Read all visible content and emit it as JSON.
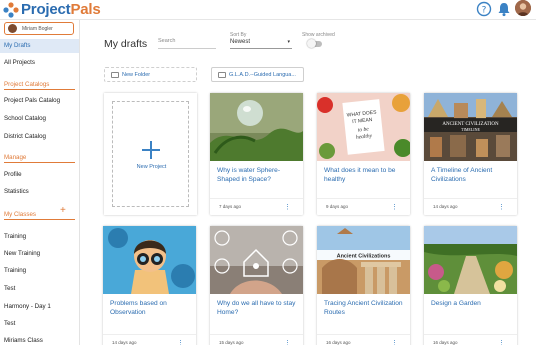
{
  "app": {
    "name_part1": "Project",
    "name_part2": "Pals"
  },
  "header": {
    "help_icon": "help-circle-icon",
    "bell_icon": "bell-icon"
  },
  "sidebar": {
    "user_name": "Miriam Bogler",
    "items_top": [
      {
        "label": "My Drafts",
        "active": true
      },
      {
        "label": "All Projects",
        "active": false
      }
    ],
    "catalogs_title": "Project Catalogs",
    "catalogs": [
      "Project Pals Catalog",
      "School Catalog",
      "District Catalog"
    ],
    "manage_title": "Manage",
    "manage": [
      "Profile",
      "Statistics"
    ],
    "classes_title": "My Classes",
    "classes": [
      "Training",
      "New Training",
      "Training",
      "Test",
      "Harmony - Day 1",
      "Test",
      "Miriams Class"
    ]
  },
  "main": {
    "title": "My drafts",
    "search_placeholder": "Search",
    "sort_label": "Sort By",
    "sort_value": "Newest",
    "archived_label": "Show archived",
    "new_folder": "New Folder",
    "folder_name": "G.L.A.D.--Guided Langua...",
    "new_project": "New Project",
    "cards": [
      {
        "title": "Why is water Sphere-Shaped in Space?",
        "date": "7 days ago"
      },
      {
        "title": "What does it mean to be healthy",
        "date": "9 days ago"
      },
      {
        "title": "A Timeline of Ancient Civilizations",
        "date": "14 days ago"
      },
      {
        "title": "Problems based on Observation",
        "date": "14 days ago"
      },
      {
        "title": "Why do we all have to stay Home?",
        "date": "15 days ago"
      },
      {
        "title": "Tracing Ancient Civilization Routes",
        "date": "16 days ago"
      },
      {
        "title": "Design a Garden",
        "date": "16 days ago"
      }
    ],
    "thumb_texts": {
      "healthy_note": "WHAT DOES IT MEAN to be healthy",
      "timeline_banner": "ANCIENT CIVILIZATION TIMELINE",
      "routes_banner": "Ancient Civilizations"
    }
  },
  "colors": {
    "brand_blue": "#2b6cb0",
    "brand_orange": "#e07b39",
    "active_bg": "#dfe9f6"
  }
}
